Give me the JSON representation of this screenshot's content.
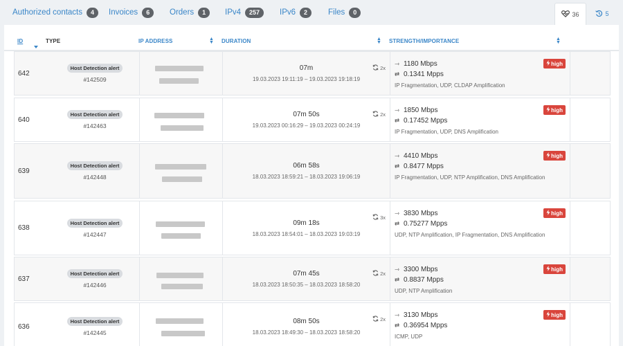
{
  "tabs": [
    {
      "label": "Authorized contacts",
      "count": "4"
    },
    {
      "label": "Invoices",
      "count": "6"
    },
    {
      "label": "Orders",
      "count": "1"
    },
    {
      "label": "IPv4",
      "count": "257"
    },
    {
      "label": "IPv6",
      "count": "2"
    },
    {
      "label": "Files",
      "count": "0"
    }
  ],
  "right_tabs": [
    {
      "icon": "heart-pulse-icon",
      "count": "36",
      "active": true
    },
    {
      "icon": "history-icon",
      "count": "5",
      "active": false
    }
  ],
  "table": {
    "headers": {
      "id": "ID",
      "type": "TYPE",
      "ip": "IP ADDRESS",
      "duration": "DURATION",
      "strength": "STRENGTH/IMPORTANCE"
    },
    "rows": [
      {
        "id": "642",
        "type": "Host Detection alert",
        "alert_no": "#142509",
        "duration": "07m",
        "range": "19.03.2023 19:11:19 – 19.03.2023 19:18:19",
        "repeat": "2x",
        "bandwidth": "1180 Mbps",
        "packets": "0.1341 Mpps",
        "protocols": "IP Fragmentation, UDP, CLDAP Amplification",
        "importance": "high"
      },
      {
        "id": "640",
        "type": "Host Detection alert",
        "alert_no": "#142463",
        "duration": "07m 50s",
        "range": "19.03.2023 00:16:29 – 19.03.2023 00:24:19",
        "repeat": "2x",
        "bandwidth": "1850 Mbps",
        "packets": "0.17452 Mpps",
        "protocols": "IP Fragmentation, UDP, DNS Amplification",
        "importance": "high"
      },
      {
        "id": "639",
        "type": "Host Detection alert",
        "alert_no": "#142448",
        "duration": "06m 58s",
        "range": "18.03.2023 18:59:21 – 18.03.2023 19:06:19",
        "repeat": "",
        "bandwidth": "4410 Mbps",
        "packets": "0.8477 Mpps",
        "protocols": "IP Fragmentation, UDP, NTP Amplification, DNS Amplification",
        "importance": "high"
      },
      {
        "id": "638",
        "type": "Host Detection alert",
        "alert_no": "#142447",
        "duration": "09m 18s",
        "range": "18.03.2023 18:54:01 – 18.03.2023 19:03:19",
        "repeat": "3x",
        "bandwidth": "3830 Mbps",
        "packets": "0.75277 Mpps",
        "protocols": "UDP, NTP Amplification, IP Fragmentation, DNS Amplification",
        "importance": "high"
      },
      {
        "id": "637",
        "type": "Host Detection alert",
        "alert_no": "#142446",
        "duration": "07m 45s",
        "range": "18.03.2023 18:50:35 – 18.03.2023 18:58:20",
        "repeat": "2x",
        "bandwidth": "3300 Mbps",
        "packets": "0.8837 Mpps",
        "protocols": "UDP, NTP Amplification",
        "importance": "high"
      },
      {
        "id": "636",
        "type": "Host Detection alert",
        "alert_no": "#142445",
        "duration": "08m 50s",
        "range": "18.03.2023 18:49:30 – 18.03.2023 18:58:20",
        "repeat": "2x",
        "bandwidth": "3130 Mbps",
        "packets": "0.36954 Mpps",
        "protocols": "ICMP, UDP",
        "importance": "high"
      }
    ]
  }
}
